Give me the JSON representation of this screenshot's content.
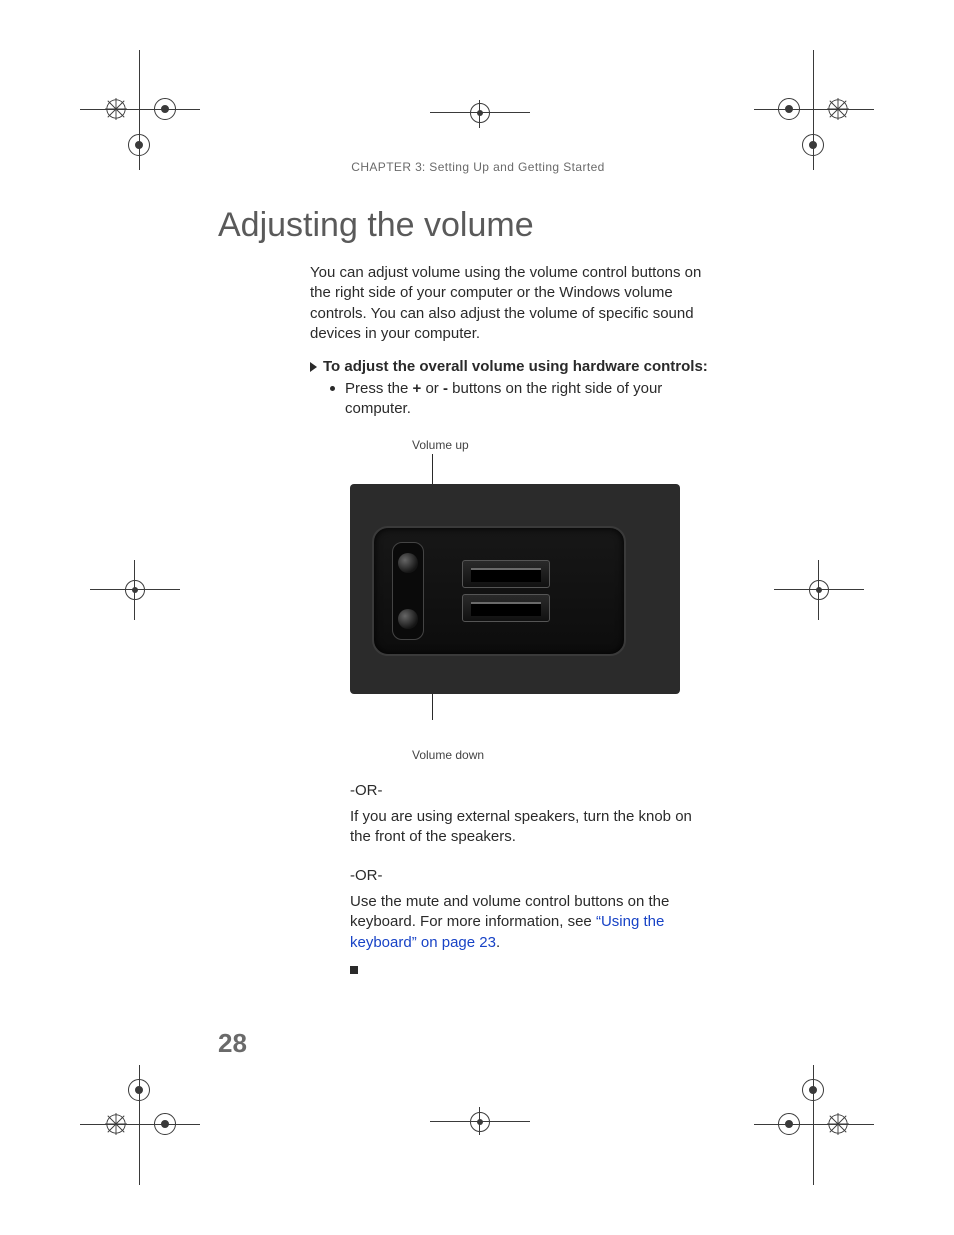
{
  "header": {
    "chapter_label": "CHAPTER",
    "chapter_number": "3",
    "chapter_separator": ":",
    "chapter_title": "Setting Up and Getting Started"
  },
  "title": "Adjusting the volume",
  "intro": "You can adjust volume using the volume control buttons on the right side of your computer or the Windows volume controls. You can also adjust the volume of specific sound devices in your computer.",
  "procedure_heading": "To adjust the overall volume using hardware controls:",
  "step1": {
    "prefix": "Press the ",
    "plus": "+",
    "mid": " or ",
    "minus": "-",
    "suffix": " buttons on the right side of your computer."
  },
  "figure": {
    "label_up": "Volume up",
    "label_down": "Volume down"
  },
  "or_label": "-OR-",
  "alt1": "If you are using external speakers, turn the knob on the front of the speakers.",
  "alt2_prefix": "Use the mute and volume control buttons on the keyboard. For more information, see ",
  "alt2_link": "“Using the keyboard” on page 23",
  "alt2_suffix": ".",
  "page_number": "28"
}
